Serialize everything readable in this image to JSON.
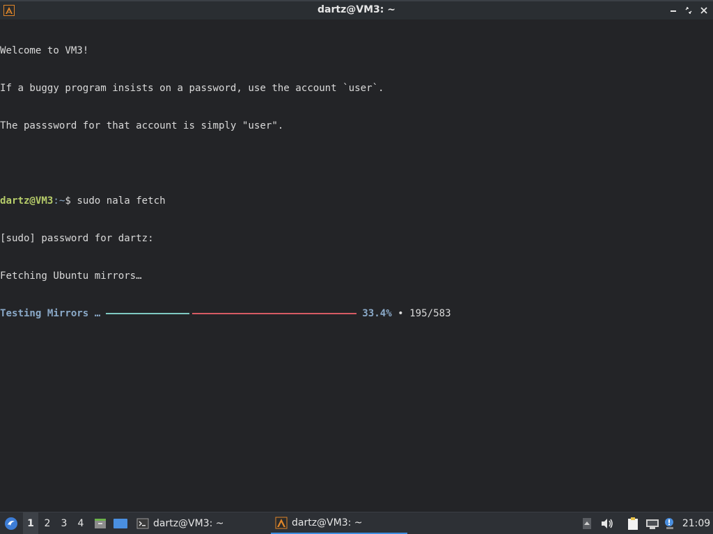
{
  "window": {
    "title": "dartz@VM3: ~"
  },
  "terminal": {
    "welcome": "Welcome to VM3!",
    "info1": "If a buggy program insists on a password, use the account `user`.",
    "info2": "The passsword for that account is simply \"user\".",
    "blank": "",
    "prompt_user": "dartz@VM3",
    "prompt_path": ":~",
    "prompt_symbol": "$ ",
    "command": "sudo nala fetch",
    "sudo_prompt": "[sudo] password for dartz:",
    "fetching": "Fetching Ubuntu mirrors…",
    "progress_label": "Testing Mirrors …",
    "progress_percent": "33.4%",
    "progress_separator": " • ",
    "progress_count": "195/583",
    "progress_fraction": 0.334
  },
  "taskbar": {
    "launcher_icon": "lxqt-menu-icon",
    "workspaces": [
      "1",
      "2",
      "3",
      "4"
    ],
    "active_workspace": "1",
    "tasks": [
      {
        "icon": "terminal-icon",
        "label": "dartz@VM3: ~"
      },
      {
        "icon": "alacritty-icon",
        "label": "dartz@VM3: ~"
      }
    ],
    "clock": "21:09"
  },
  "colors": {
    "background": "#232427",
    "prompt_user": "#b6cc6a",
    "accent_blue": "#8aa9c8",
    "progress_done": "#7fc9c3",
    "progress_remaining": "#d65b64",
    "taskbar": "#2d3035",
    "active_task_underline": "#3d8ee0"
  }
}
